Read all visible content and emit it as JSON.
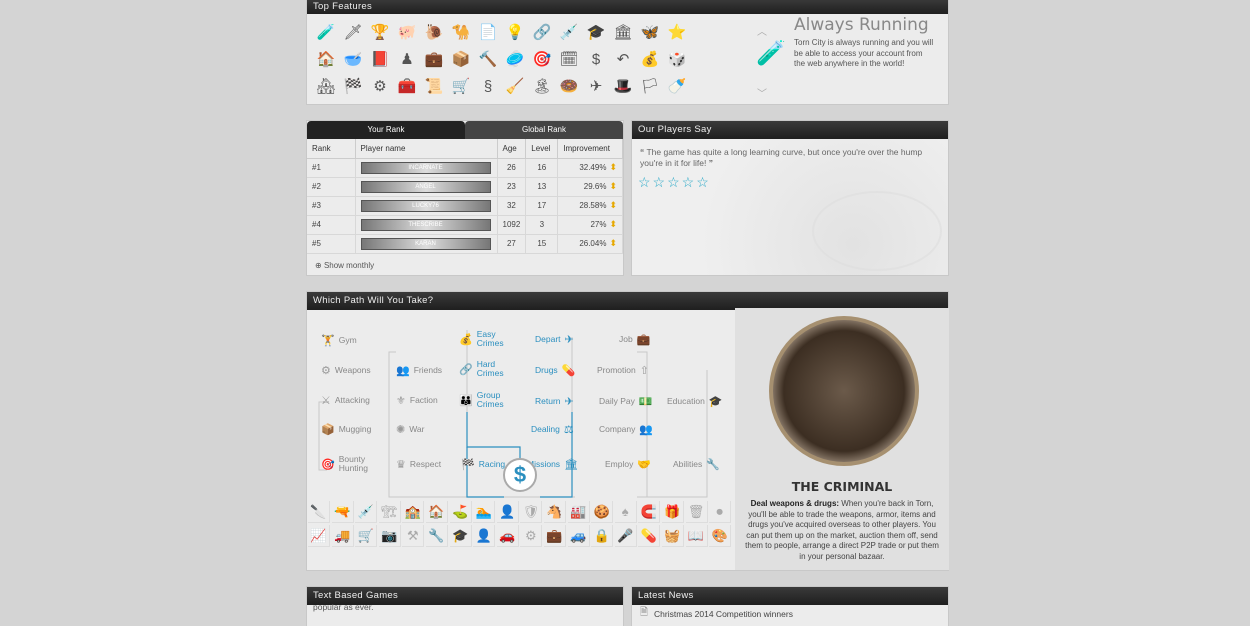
{
  "features": {
    "title": "Top Features",
    "feature_title": "Always Running",
    "feature_desc": "Torn City is always running and you will be able to access your account from the web anywhere in the world!",
    "icons": [
      "🧪",
      "🗡",
      "🏆",
      "🐖",
      "🐌",
      "🐪",
      "📄",
      "💡",
      "🔗",
      "💉",
      "🎓",
      "🏛",
      "🦋",
      "⭐",
      "🏠",
      "🥣",
      "📕",
      "♟",
      "💼",
      "📦",
      "🔨",
      "🥏",
      "🎯",
      "🗓",
      "$",
      "↶",
      "💰",
      "🎲",
      "🏘",
      "🏁",
      "⚙",
      "🧰",
      "📜",
      "🛒",
      "§",
      "🧹",
      "🏝",
      "🍩",
      "✈",
      "🎩",
      "🏳",
      "🍼"
    ]
  },
  "ranks": {
    "tab_your": "Your Rank",
    "tab_global": "Global Rank",
    "columns": [
      "Rank",
      "Player name",
      "Age",
      "Level",
      "Improvement"
    ],
    "rows": [
      {
        "rank": "#1",
        "player": "INCARNATE",
        "age": "26",
        "level": "16",
        "improvement": "32.49%"
      },
      {
        "rank": "#2",
        "player": "ANGEL",
        "age": "23",
        "level": "13",
        "improvement": "29.6%"
      },
      {
        "rank": "#3",
        "player": "LUCKY76",
        "age": "32",
        "level": "17",
        "improvement": "28.58%"
      },
      {
        "rank": "#4",
        "player": "THESCRIBE",
        "age": "1092",
        "level": "3",
        "improvement": "27%"
      },
      {
        "rank": "#5",
        "player": "KARAN",
        "age": "27",
        "level": "15",
        "improvement": "26.04%"
      }
    ],
    "show_monthly": "Show monthly"
  },
  "players_say": {
    "title": "Our Players Say",
    "quote_open": "“",
    "quote": "The game has quite a long learning curve, but once you're over the hump you're in it for life!",
    "quote_close": "”",
    "stars": "☆☆☆☆☆"
  },
  "paths": {
    "title": "Which Path Will You Take?",
    "items": [
      {
        "label": "Gym",
        "icon": "🏋"
      },
      {
        "label": "Weapons",
        "icon": "⚙"
      },
      {
        "label": "Attacking",
        "icon": "⚔"
      },
      {
        "label": "Mugging",
        "icon": "📦"
      },
      {
        "label": "Bounty\nHunting",
        "icon": "🎯"
      },
      {
        "label": "Friends",
        "icon": "👥"
      },
      {
        "label": "Faction",
        "icon": "⚜"
      },
      {
        "label": "War",
        "icon": "✺"
      },
      {
        "label": "Respect",
        "icon": "♛"
      },
      {
        "label": "Easy\nCrimes",
        "icon": "💰"
      },
      {
        "label": "Hard\nCrimes",
        "icon": "🔗"
      },
      {
        "label": "Group\nCrimes",
        "icon": "👪"
      },
      {
        "label": "Racing",
        "icon": "🏁"
      },
      {
        "label": "Depart",
        "icon": "✈"
      },
      {
        "label": "Drugs",
        "icon": "💊"
      },
      {
        "label": "Return",
        "icon": "✈"
      },
      {
        "label": "Dealing",
        "icon": "⚖"
      },
      {
        "label": "Missions",
        "icon": "🏛"
      },
      {
        "label": "Job",
        "icon": "💼"
      },
      {
        "label": "Promotion",
        "icon": "⇧"
      },
      {
        "label": "Daily Pay",
        "icon": "💵"
      },
      {
        "label": "Company",
        "icon": "👥"
      },
      {
        "label": "Employ",
        "icon": "🤝"
      },
      {
        "label": "Education",
        "icon": "🎓"
      },
      {
        "label": "Abilities",
        "icon": "🔧"
      }
    ],
    "dollar": "$",
    "criminal_title": "THE CRIMINAL",
    "criminal_lead": "Deal weapons & drugs:",
    "criminal_text": "When you're back in Torn, you'll be able to trade the weapons, armor, items and drugs you've acquired overseas to other players. You can put them up on the market, auction them off, send them to people, arrange a direct P2P trade or put them in your personal bazaar.",
    "bottom_icons": [
      "🔪",
      "🔫",
      "💉",
      "🏗",
      "🏫",
      "🏠",
      "⛳",
      "🏊",
      "👤",
      "🛡",
      "🐴",
      "🏭",
      "🍪",
      "♠",
      "🧲",
      "🎁",
      "🗑",
      "⏺",
      "📈",
      "🚚",
      "🛒",
      "📷",
      "⚒",
      "🔧",
      "🎓",
      "👤",
      "🚗",
      "⚙",
      "💼",
      "🚙",
      "🔒",
      "🎤",
      "💊",
      "🧺",
      "📖",
      "🎨"
    ]
  },
  "games": {
    "title": "Text Based Games",
    "snippet": "popular as ever."
  },
  "news": {
    "title": "Latest News",
    "item": "Christmas 2014 Competition winners"
  }
}
